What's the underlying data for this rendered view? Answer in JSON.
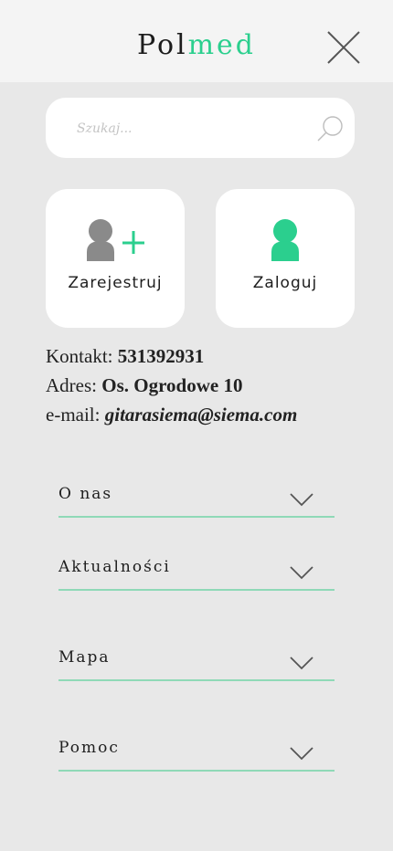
{
  "header": {
    "logo_part1": "Pol",
    "logo_part2": "med",
    "close_icon": "close-icon"
  },
  "search": {
    "placeholder": "Szukaj...",
    "value": "",
    "icon": "search-icon"
  },
  "cards": {
    "register": {
      "label": "Zarejestruj",
      "icon": "add-user-icon"
    },
    "login": {
      "label": "Zaloguj",
      "icon": "user-icon"
    }
  },
  "contact": {
    "phone_label": "Kontakt:",
    "phone_value": "531392931",
    "address_label": "Adres:",
    "address_value": "Os. Ogrodowe 10",
    "email_label": "e-mail:",
    "email_value": "gitarasiema@siema.com"
  },
  "menu": {
    "items": [
      {
        "label": "O nas"
      },
      {
        "label": "Aktualności"
      },
      {
        "label": "Mapa"
      },
      {
        "label": "Pomoc"
      }
    ],
    "chevron_icon": "chevron-down-icon"
  },
  "colors": {
    "accent": "#2bcf8e",
    "divider": "#8fd9b7",
    "background": "#e8e8e8",
    "header_bg": "#f4f4f4",
    "grey_icon": "#8a8a8a"
  }
}
